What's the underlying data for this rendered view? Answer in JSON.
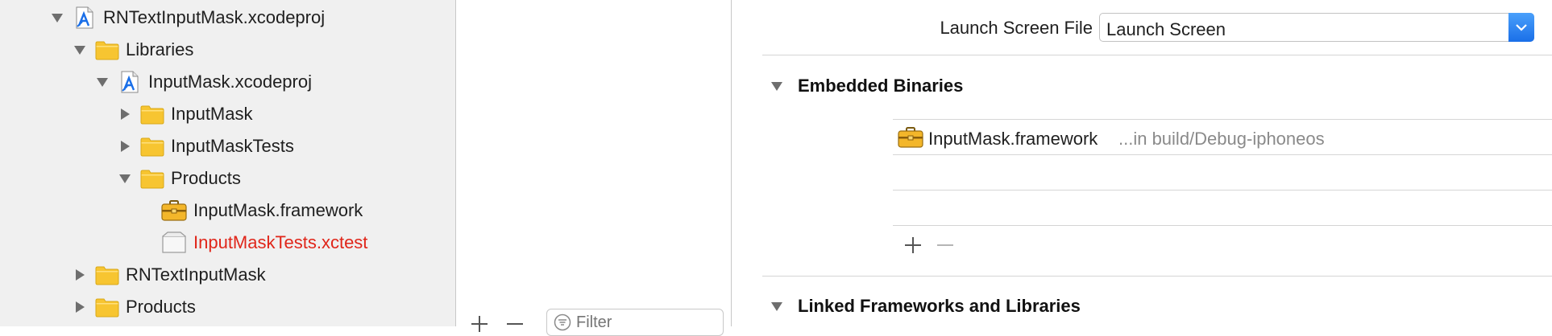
{
  "navigator": {
    "items": [
      {
        "label": "RNTextInputMask.xcodeproj",
        "icon": "xcodeproj-icon",
        "expanded": true,
        "state": "normal"
      },
      {
        "label": "Libraries",
        "icon": "folder-icon",
        "expanded": true,
        "state": "normal"
      },
      {
        "label": "InputMask.xcodeproj",
        "icon": "xcodeproj-icon",
        "expanded": true,
        "state": "normal"
      },
      {
        "label": "InputMask",
        "icon": "folder-icon",
        "expanded": false,
        "state": "normal"
      },
      {
        "label": "InputMaskTests",
        "icon": "folder-icon",
        "expanded": false,
        "state": "normal"
      },
      {
        "label": "Products",
        "icon": "folder-icon",
        "expanded": true,
        "state": "normal"
      },
      {
        "label": "InputMask.framework",
        "icon": "framework-icon",
        "expanded": null,
        "state": "normal"
      },
      {
        "label": "InputMaskTests.xctest",
        "icon": "xctest-icon",
        "expanded": null,
        "state": "missing"
      },
      {
        "label": "RNTextInputMask",
        "icon": "folder-icon",
        "expanded": false,
        "state": "normal"
      },
      {
        "label": "Products",
        "icon": "folder-icon",
        "expanded": false,
        "state": "normal"
      }
    ]
  },
  "targets": {
    "filter_placeholder": "Filter"
  },
  "editor": {
    "launch_screen": {
      "label": "Launch Screen File",
      "value": "Launch Screen"
    },
    "embedded_binaries": {
      "title": "Embedded Binaries",
      "items": [
        {
          "name": "InputMask.framework",
          "path": "...in build/Debug-iphoneos",
          "icon": "framework-icon"
        }
      ]
    },
    "linked_frameworks": {
      "title": "Linked Frameworks and Libraries"
    }
  },
  "colors": {
    "missing_file": "#e0261a",
    "accent_blue": "#1a6fe8",
    "folder": "#f7c531"
  }
}
